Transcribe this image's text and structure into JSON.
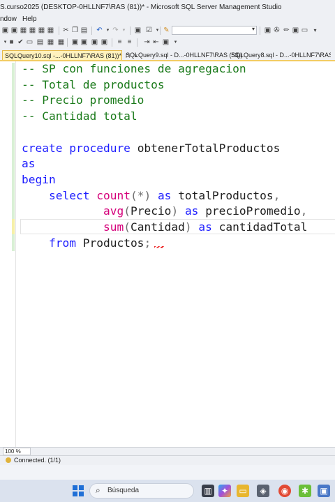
{
  "window": {
    "title": "S.curso2025 (DESKTOP-0HLLNF7\\RAS (81))* - Microsoft SQL Server Management Studio"
  },
  "menu": {
    "items": [
      "ndow",
      "Help"
    ]
  },
  "tabs": [
    {
      "label": "SQLQuery10.sql -...-0HLLNF7\\RAS (81))*",
      "pin": "⊓",
      "close": "×"
    },
    {
      "label": "SQLQuery9.sql - D...-0HLLNF7\\RAS (53))"
    },
    {
      "label": "SQLQuery8.sql - D...-0HLLNF7\\RAS ("
    }
  ],
  "editor": {
    "lines": [
      {
        "segments": [
          {
            "cls": "c",
            "text": "-- SP con funciones de agregacion"
          }
        ]
      },
      {
        "segments": [
          {
            "cls": "c",
            "text": "-- Total de productos"
          }
        ]
      },
      {
        "segments": [
          {
            "cls": "c",
            "text": "-- Precio promedio"
          }
        ]
      },
      {
        "segments": [
          {
            "cls": "c",
            "text": "-- Cantidad total"
          }
        ]
      },
      {
        "segments": []
      },
      {
        "segments": [
          {
            "cls": "k",
            "text": "create procedure "
          },
          {
            "cls": "t",
            "text": "obtenerTotalProductos"
          }
        ]
      },
      {
        "segments": [
          {
            "cls": "k",
            "text": "as"
          }
        ]
      },
      {
        "segments": [
          {
            "cls": "k",
            "text": "begin"
          }
        ]
      },
      {
        "segments": [
          {
            "cls": "t",
            "text": "    "
          },
          {
            "cls": "k",
            "text": "select "
          },
          {
            "cls": "f",
            "text": "count"
          },
          {
            "cls": "g",
            "text": "(*) "
          },
          {
            "cls": "k",
            "text": "as "
          },
          {
            "cls": "t",
            "text": "totalProductos"
          },
          {
            "cls": "g",
            "text": ","
          }
        ]
      },
      {
        "segments": [
          {
            "cls": "t",
            "text": "            "
          },
          {
            "cls": "f",
            "text": "avg"
          },
          {
            "cls": "g",
            "text": "("
          },
          {
            "cls": "t",
            "text": "Precio"
          },
          {
            "cls": "g",
            "text": ") "
          },
          {
            "cls": "k",
            "text": "as "
          },
          {
            "cls": "t",
            "text": "precioPromedio"
          },
          {
            "cls": "g",
            "text": ","
          }
        ]
      },
      {
        "segments": [
          {
            "cls": "t",
            "text": "            "
          },
          {
            "cls": "f",
            "text": "sum"
          },
          {
            "cls": "g",
            "text": "("
          },
          {
            "cls": "t",
            "text": "Cantidad"
          },
          {
            "cls": "g",
            "text": ") "
          },
          {
            "cls": "k",
            "text": "as "
          },
          {
            "cls": "t",
            "text": "cantidadTotal"
          }
        ]
      },
      {
        "segments": [
          {
            "cls": "t",
            "text": "    "
          },
          {
            "cls": "k",
            "text": "from "
          },
          {
            "cls": "t",
            "text": "Productos"
          },
          {
            "cls": "g",
            "text": ";"
          }
        ]
      }
    ]
  },
  "zoom": {
    "value": "100 %"
  },
  "status": {
    "text": "Connected. (1/1)"
  },
  "taskbar": {
    "search_label": "Búsqueda"
  },
  "colors": {
    "comment": "#1a7a1a",
    "keyword": "#1d1dff",
    "function": "#d5007a",
    "active_tab": "#fff1bd"
  }
}
